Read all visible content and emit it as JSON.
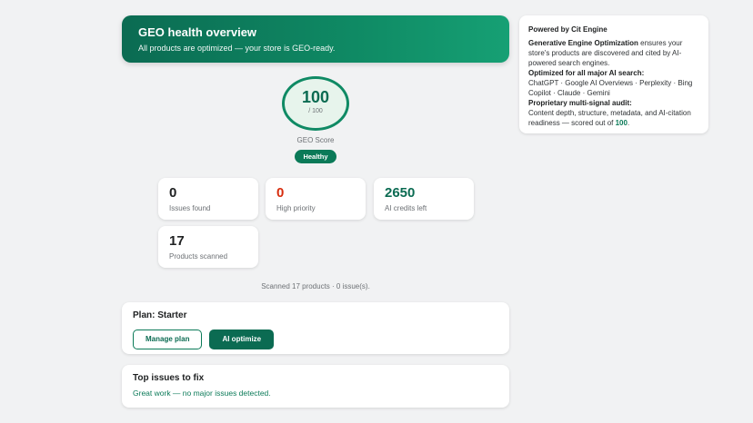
{
  "hero": {
    "title": "GEO health overview",
    "subtitle": "All products are optimized — your store is GEO-ready."
  },
  "sidebar": {
    "heading": "Powered by Cit Engine",
    "intro_bold": "Generative Engine Optimization",
    "intro_rest": " ensures your store's products are discovered and cited by AI-powered search engines.",
    "engines_heading": "Optimized for all major AI search:",
    "engines_list": "ChatGPT · Google AI Overviews · Perplexity · Bing Copilot · Claude · Gemini",
    "audit_heading": "Proprietary multi-signal audit:",
    "audit_text": "Content depth, structure, metadata, and AI-citation readiness — scored out of ",
    "audit_max": "100",
    "audit_end": "."
  },
  "score": {
    "value": "100",
    "max": "/ 100",
    "label": "GEO Score",
    "badge": "Healthy"
  },
  "stats": {
    "issues": {
      "value": "0",
      "label": "Issues found"
    },
    "high_priority": {
      "value": "0",
      "label": "High priority"
    },
    "credits": {
      "value": "2650",
      "label": "AI credits left"
    },
    "products": {
      "value": "17",
      "label": "Products scanned"
    }
  },
  "scan_summary": "Scanned 17 products · 0 issue(s).",
  "plan": {
    "title": "Plan: Starter",
    "manage_label": "Manage plan",
    "optimize_label": "AI optimize"
  },
  "top_issues": {
    "title": "Top issues to fix",
    "message": "Great work — no major issues detected."
  },
  "colors": {
    "brand": "#0b6b52",
    "danger": "#d72c0d",
    "background": "#f1f2f3"
  }
}
